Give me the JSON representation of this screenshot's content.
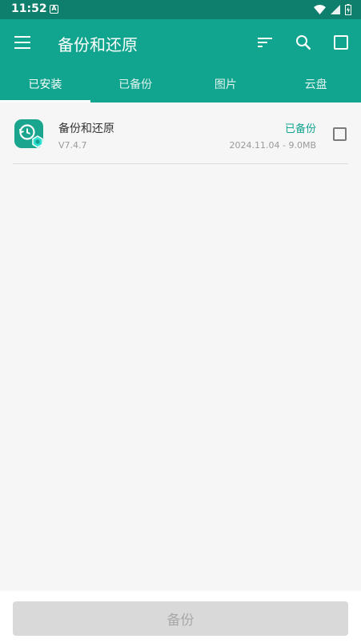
{
  "status_bar": {
    "time": "11:52",
    "notification_glyph": "A"
  },
  "app_bar": {
    "title": "备份和还原"
  },
  "tabs": [
    {
      "label": "已安装",
      "active": true
    },
    {
      "label": "已备份",
      "active": false
    },
    {
      "label": "图片",
      "active": false
    },
    {
      "label": "云盘",
      "active": false
    }
  ],
  "items": [
    {
      "name": "备份和还原",
      "version": "V7.4.7",
      "status": "已备份",
      "meta": "2024.11.04 - 9.0MB",
      "checked": false
    }
  ],
  "bottom": {
    "button_label": "备份"
  },
  "colors": {
    "primary": "#11a48e",
    "status_bar": "#0e7f6c",
    "accent_text": "#11a48e"
  }
}
